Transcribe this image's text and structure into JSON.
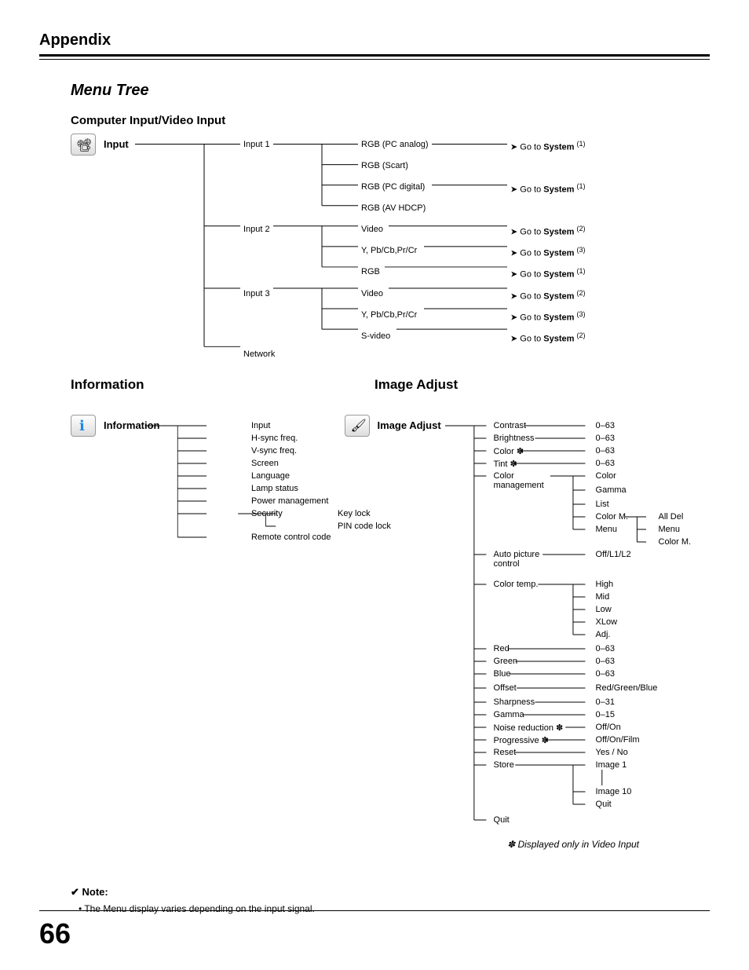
{
  "header": {
    "title": "Appendix"
  },
  "menu_tree_title": "Menu Tree",
  "computer_input": {
    "title": "Computer Input/Video Input",
    "root": "Input",
    "inputs": [
      {
        "name": "Input 1",
        "items": [
          {
            "label": "RGB (PC analog)",
            "goto": "Go to ",
            "sys": "System",
            "sup": "(1)"
          },
          {
            "label": "RGB (Scart)"
          },
          {
            "label": "RGB (PC digital)",
            "goto": "Go to ",
            "sys": "System",
            "sup": "(1)"
          },
          {
            "label": "RGB (AV HDCP)"
          }
        ]
      },
      {
        "name": "Input 2",
        "items": [
          {
            "label": "Video",
            "goto": "Go to ",
            "sys": "System",
            "sup": "(2)"
          },
          {
            "label": "Y, Pb/Cb,Pr/Cr",
            "goto": "Go to ",
            "sys": "System",
            "sup": "(3)"
          },
          {
            "label": "RGB",
            "goto": "Go to ",
            "sys": "System",
            "sup": "(1)"
          }
        ]
      },
      {
        "name": "Input 3",
        "items": [
          {
            "label": "Video",
            "goto": "Go to ",
            "sys": "System",
            "sup": "(2)"
          },
          {
            "label": "Y, Pb/Cb,Pr/Cr",
            "goto": "Go to ",
            "sys": "System",
            "sup": "(3)"
          },
          {
            "label": "S-video",
            "goto": "Go to ",
            "sys": "System",
            "sup": "(2)"
          }
        ]
      },
      {
        "name": "Network"
      }
    ]
  },
  "information": {
    "title": "Information",
    "root": "Information",
    "items": [
      "Input",
      "H-sync freq.",
      "V-sync freq.",
      "Screen",
      "Language",
      "Lamp status",
      "Power management",
      "Security",
      "Remote control code"
    ],
    "security_sub": [
      "Key lock",
      "PIN code lock"
    ]
  },
  "image_adjust": {
    "title": "Image Adjust",
    "root": "Image Adjust",
    "items": [
      {
        "label": "Contrast",
        "val": "0–63"
      },
      {
        "label": "Brightness",
        "val": "0–63"
      },
      {
        "label": "Color ✽",
        "val": "0–63"
      },
      {
        "label": "Tint ✽",
        "val": "0–63"
      },
      {
        "label": "Color management",
        "sub": [
          "Color",
          "Gamma",
          "List",
          "Color M.",
          "Menu"
        ],
        "subsub": [
          "All Del",
          "Menu",
          "Color M."
        ]
      },
      {
        "label": "Auto picture control",
        "val": "Off/L1/L2"
      },
      {
        "label": "Color temp.",
        "sub": [
          "High",
          "Mid",
          "Low",
          "XLow",
          "Adj."
        ]
      },
      {
        "label": "Red",
        "val": "0–63"
      },
      {
        "label": "Green",
        "val": "0–63"
      },
      {
        "label": "Blue",
        "val": "0–63"
      },
      {
        "label": "Offset",
        "val": "Red/Green/Blue"
      },
      {
        "label": "Sharpness",
        "val": "0–31"
      },
      {
        "label": "Gamma",
        "val": "0–15"
      },
      {
        "label": "Noise reduction ✽",
        "val": "Off/On"
      },
      {
        "label": "Progressive ✽",
        "val": "Off/On/Film"
      },
      {
        "label": "Reset",
        "val": "Yes / No"
      },
      {
        "label": "Store",
        "sub": [
          "Image 1",
          "Image 10",
          "Quit"
        ]
      },
      {
        "label": "Quit"
      }
    ]
  },
  "asterisk_note": "✽  Displayed only in Video Input",
  "note": {
    "title": "✔ Note:",
    "text": "• The Menu display varies depending on the input signal."
  },
  "page_number": "66"
}
